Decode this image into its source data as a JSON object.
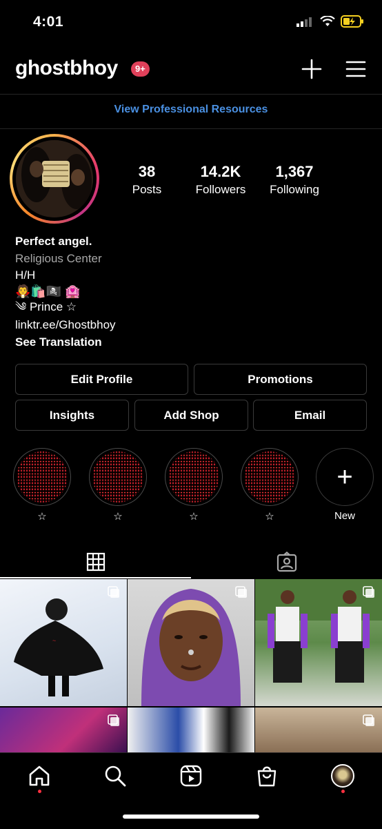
{
  "status": {
    "time": "4:01"
  },
  "header": {
    "username": "ghostbhoy",
    "notif_badge": "9+"
  },
  "pro_resources": "View Professional Resources",
  "stats": [
    {
      "num": "38",
      "label": "Posts"
    },
    {
      "num": "14.2K",
      "label": "Followers"
    },
    {
      "num": "1,367",
      "label": "Following"
    }
  ],
  "bio": {
    "name": "Perfect angel.",
    "category": "Religious Center",
    "line1": "H/H",
    "emojis": "🧛🛍️🏴‍☠️ 🏩",
    "line2": "༄ Prince ☆",
    "link": "linktr.ee/Ghostbhoy",
    "translation": "See Translation"
  },
  "buttons": {
    "edit_profile": "Edit Profile",
    "promotions": "Promotions",
    "insights": "Insights",
    "add_shop": "Add Shop",
    "email": "Email"
  },
  "highlights": [
    {
      "label": "☆"
    },
    {
      "label": "☆"
    },
    {
      "label": "☆"
    },
    {
      "label": "☆"
    }
  ],
  "new_highlight": {
    "icon": "+",
    "label": "New"
  },
  "tabs": {
    "grid_icon": "grid-icon",
    "tagged_icon": "tagged-icon"
  },
  "posts_count_visible": 6,
  "colors": {
    "accent_link": "#4a90e2",
    "badge": "#e0405a",
    "background": "#000000"
  }
}
